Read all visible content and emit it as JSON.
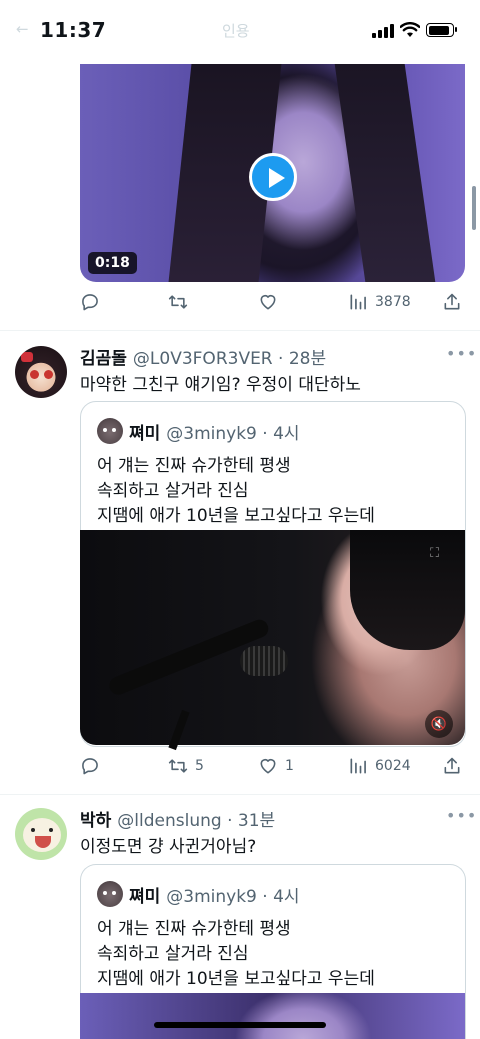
{
  "status_bar": {
    "time": "11:37",
    "faint_center": "인용",
    "faint_left": "←"
  },
  "tweets": [
    {
      "video": {
        "duration": "0:18"
      },
      "actions": {
        "reply": "",
        "retweet": "",
        "like": "",
        "views": "3878"
      }
    },
    {
      "name": "김곰돌",
      "handle": "@L0V3FOR3VER · 28분",
      "text": "마약한 그친구 얘기임? 우정이 대단하노",
      "quote": {
        "name": "쪄미",
        "handle": "@3minyk9 · 4시",
        "lines": [
          "어 걔는 진짜 슈가한테 평생",
          "속죄하고 살거라 진심",
          "지땜에 애가 10년을 보고싶다고 우는데"
        ]
      },
      "actions": {
        "reply": "",
        "retweet": "5",
        "like": "1",
        "views": "6024"
      }
    },
    {
      "name": "박하",
      "handle": "@lldenslung · 31분",
      "text": "이정도면 걍 사귄거아님?",
      "quote": {
        "name": "쪄미",
        "handle": "@3minyk9 · 4시",
        "lines": [
          "어 걔는 진짜 슈가한테 평생",
          "속죄하고 살거라 진심",
          "지땜에 애가 10년을 보고싶다고 우는데"
        ]
      }
    }
  ],
  "icons": [
    "reply-icon",
    "retweet-icon",
    "like-icon",
    "views-icon",
    "share-icon",
    "more-icon",
    "play-icon",
    "mute-icon"
  ],
  "colors": {
    "accent": "#1d9bf0",
    "secondary_text": "#536471",
    "border": "#cfd9de"
  }
}
